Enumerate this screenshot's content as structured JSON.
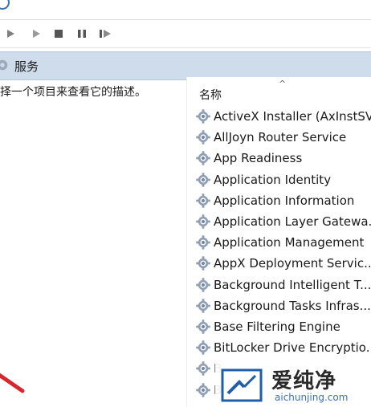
{
  "header": {
    "title": "服务"
  },
  "description": "择一个项目来查看它的描述。",
  "list": {
    "column_name": "名称",
    "sort_glyph": "^",
    "services": [
      "ActiveX Installer (AxInstSV)",
      "AllJoyn Router Service",
      "App Readiness",
      "Application Identity",
      "Application Information",
      "Application Layer Gatewa...",
      "Application Management",
      "AppX Deployment Servic...",
      "Background Intelligent T...",
      "Background Tasks Infras...",
      "Base Filtering Engine",
      "BitLocker Drive Encryptio...",
      "B",
      "B"
    ]
  },
  "watermark": {
    "brand": "爱纯净",
    "url": "aichunjing.com"
  },
  "icons": {
    "toolbar": [
      "play-icon",
      "play-icon",
      "stop-icon",
      "pause-icon",
      "resume-icon"
    ],
    "service": "gear-icon"
  }
}
